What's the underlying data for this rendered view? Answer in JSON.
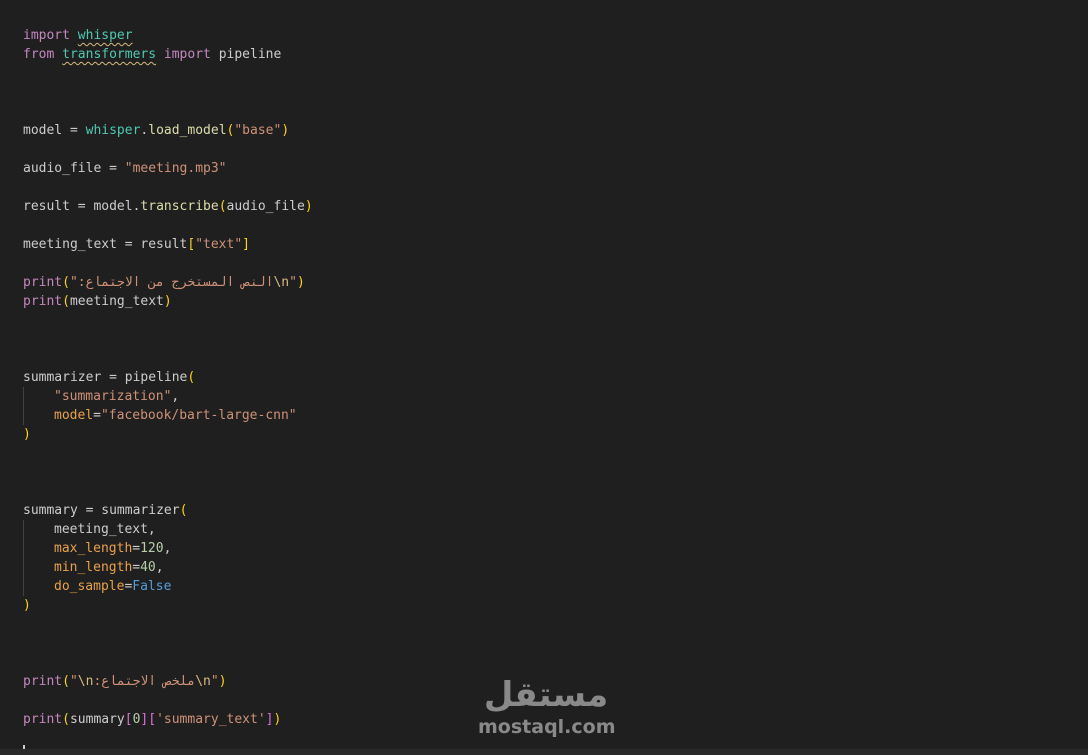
{
  "code": {
    "l1": {
      "kw": "import",
      "mod": "whisper"
    },
    "l2": {
      "kw1": "from",
      "mod": "transformers",
      "kw2": "import",
      "name": "pipeline"
    },
    "l6": {
      "var": "model",
      "op": " = ",
      "mod": "whisper",
      "dot": ".",
      "fn": "load_model",
      "arg": "\"base\""
    },
    "l8": {
      "var": "audio_file",
      "op": " = ",
      "str": "\"meeting.mp3\""
    },
    "l10": {
      "var": "result",
      "op": " = ",
      "obj": "model",
      "dot": ".",
      "fn": "transcribe",
      "arg": "audio_file"
    },
    "l12": {
      "var": "meeting_text",
      "op": " = ",
      "obj": "result",
      "key": "\"text\""
    },
    "l14": {
      "fn": "print",
      "q1": "\"",
      "ar": "النص المستخرج من الاجتماع:",
      "esc": "\\n",
      "q2": "\""
    },
    "l15": {
      "fn": "print",
      "arg": "meeting_text"
    },
    "l19": {
      "var": "summarizer",
      "op": " = ",
      "fn": "pipeline"
    },
    "l20": {
      "str": "\"summarization\"",
      "comma": ","
    },
    "l21": {
      "param": "model",
      "eq": "=",
      "str": "\"facebook/bart-large-cnn\""
    },
    "l26": {
      "var": "summary",
      "op": " = ",
      "fn": "summarizer"
    },
    "l27": {
      "arg": "meeting_text",
      "comma": ","
    },
    "l28": {
      "param": "max_length",
      "eq": "=",
      "num": "120",
      "comma": ","
    },
    "l29": {
      "param": "min_length",
      "eq": "=",
      "num": "40",
      "comma": ","
    },
    "l30": {
      "param": "do_sample",
      "eq": "=",
      "const": "False"
    },
    "l35": {
      "fn": "print",
      "q1": "\"",
      "esc1": "\\n",
      "ar": "ملخص الاجتماع:",
      "esc2": "\\n",
      "q2": "\""
    },
    "l37": {
      "fn": "print",
      "obj": "summary",
      "idx": "0",
      "key": "'summary_text'"
    }
  },
  "watermark": {
    "arabic": "مستقل",
    "latin": "mostaql.com"
  }
}
